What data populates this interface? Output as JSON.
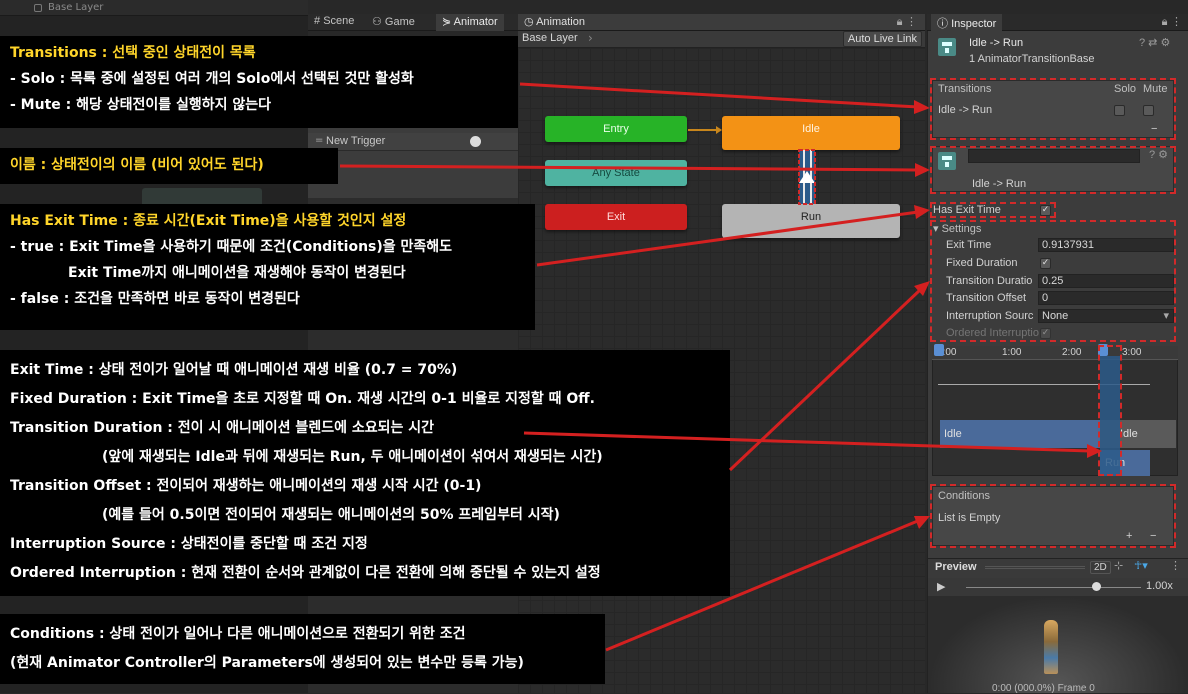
{
  "top_strip": {
    "label": "Base Layer"
  },
  "tabs": [
    {
      "label": "Scene",
      "icon": "hash-icon"
    },
    {
      "label": "Game",
      "icon": "gamepad-icon"
    },
    {
      "label": "Animator",
      "icon": "animator-icon"
    }
  ],
  "parameter": {
    "label": "New Trigger"
  },
  "animation_window": {
    "tab_label": "Animation",
    "layer": "Base Layer",
    "auto_live_link": "Auto Live Link",
    "states": {
      "entry": "Entry",
      "any": "Any State",
      "exit": "Exit",
      "idle": "Idle",
      "run": "Run"
    },
    "colors": {
      "entry": "#27b327",
      "any": "#4fb3a1",
      "exit": "#cc1f1f",
      "idle": "#f39215",
      "run": "#b4b4b4"
    }
  },
  "inspector": {
    "tab_label": "Inspector",
    "title": "Idle -> Run",
    "subtitle": "1 AnimatorTransitionBase",
    "transitions_header": "Transitions",
    "solo": "Solo",
    "mute": "Mute",
    "transition_item": "Idle -> Run",
    "name_field": "",
    "name_caption": "Idle -> Run",
    "has_exit_time_label": "Has Exit Time",
    "settings_label": "Settings",
    "settings": [
      {
        "label": "Exit Time",
        "value": "0.9137931"
      },
      {
        "label": "Fixed Duration",
        "value": "✓"
      },
      {
        "label": "Transition Duratio",
        "value": "0.25"
      },
      {
        "label": "Transition Offset",
        "value": "0"
      },
      {
        "label": "Interruption Sourc",
        "value": "None"
      },
      {
        "label": "Ordered Interruptio",
        "value": "✓"
      }
    ],
    "timeline_ticks": [
      "0:00",
      "1:00",
      "2:00",
      "3:00"
    ],
    "timeline_idle_a": "Idle",
    "timeline_idle_b": "Idle",
    "timeline_run": "Run",
    "conditions_header": "Conditions",
    "conditions_empty": "List is Empty",
    "plus": "+",
    "minus": "−",
    "preview_label": "Preview",
    "preview_2d": "2D",
    "preview_speed": "1.00x",
    "preview_frame": "0:00 (000.0%) Frame 0"
  },
  "annotations": {
    "transitions": {
      "l1a": "Transitions : ",
      "l1b": "선택 중인 상태전이 목록",
      "l2": "- Solo : 목록 중에 설정된 여러 개의 Solo에서 선택된 것만 활성화",
      "l3": "- Mute : 해당 상태전이를 실행하지 않는다"
    },
    "name": {
      "l1": "이름 : 상태전이의 이름 (비어 있어도 된다)"
    },
    "has_exit": {
      "l1a": "Has Exit Time : ",
      "l1b": "종료 시간(Exit Time)을 사용할 것인지 설정",
      "l2": "- true : Exit Time을 사용하기 때문에 조건(Conditions)을 만족해도",
      "l3": "Exit Time까지 애니메이션을 재생해야 동작이 변경된다",
      "l4": "- false : 조건을 만족하면 바로 동작이 변경된다"
    },
    "settings": {
      "l1": "Exit Time : 상태 전이가 일어날 때 애니메이션 재생 비율 (0.7 = 70%)",
      "l2": "Fixed Duration : Exit Time을 초로 지정할 때 On. 재생 시간의 0-1 비율로 지정할 때 Off.",
      "l3": "Transition Duration : 전이 시 애니메이션 블렌드에 소요되는 시간",
      "l4": "(앞에 재생되는 Idle과 뒤에 재생되는 Run, 두 애니메이션이 섞여서 재생되는 시간)",
      "l5": "Transition Offset : 전이되어 재생하는 애니메이션의 재생 시작 시간 (0-1)",
      "l6": "(예를 들어 0.5이면 전이되어 재생되는 애니메이션의 50% 프레임부터 시작)",
      "l7": "Interruption Source : 상태전이를 중단할 때 조건 지정",
      "l8": "Ordered Interruption : 현재 전환이 순서와 관계없이 다른 전환에 의해 중단될 수 있는지 설정"
    },
    "conditions": {
      "l1": "Conditions : 상태 전이가 일어나 다른 애니메이션으로 전환되기 위한 조건",
      "l2": "(현재 Animator Controller의 Parameters에 생성되어 있는 변수만 등록 가능)"
    }
  },
  "colors": {
    "annotation_accent": "#ffd52a",
    "arrow": "#d42020"
  }
}
